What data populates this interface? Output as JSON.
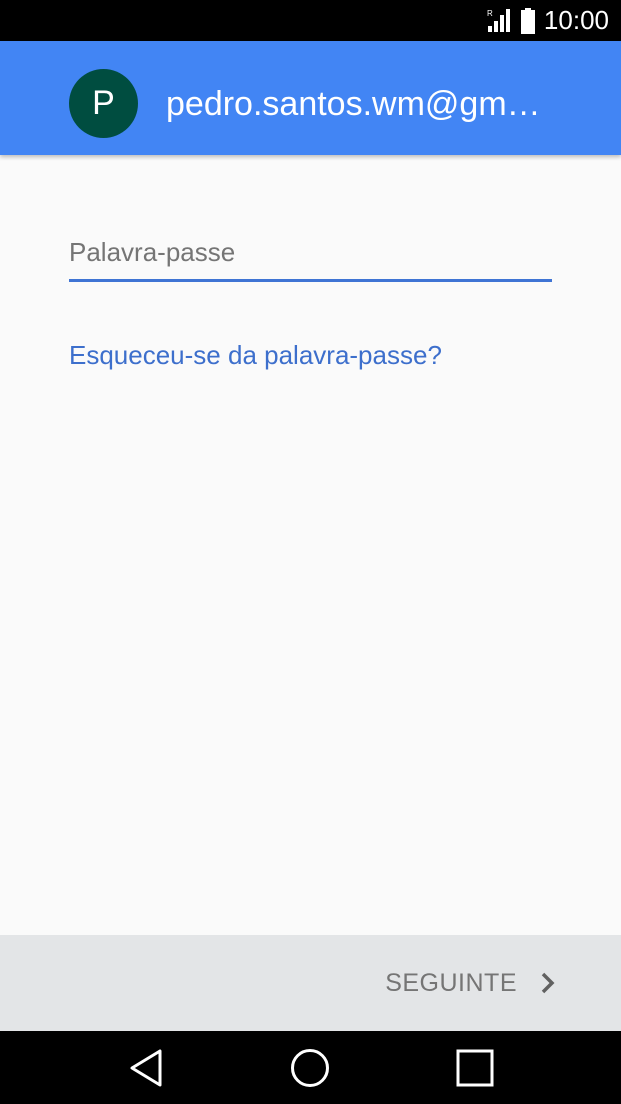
{
  "status_bar": {
    "time": "10:00",
    "roaming_indicator": "R",
    "icons": [
      "signal-icon",
      "battery-icon"
    ]
  },
  "header": {
    "avatar_letter": "P",
    "email": "pedro.santos.wm@gm…",
    "background_color": "#4285f4",
    "avatar_color": "#004d40"
  },
  "form": {
    "password_placeholder": "Palavra-passe",
    "password_value": "",
    "forgot_link": "Esqueceu-se da palavra-passe?"
  },
  "footer": {
    "next_label": "SEGUINTE",
    "next_icon": "chevron-right-icon"
  },
  "nav": {
    "icons": [
      "back-icon",
      "home-icon",
      "recents-icon"
    ]
  },
  "colors": {
    "accent": "#3f74d4",
    "link": "#3d6fcc"
  }
}
